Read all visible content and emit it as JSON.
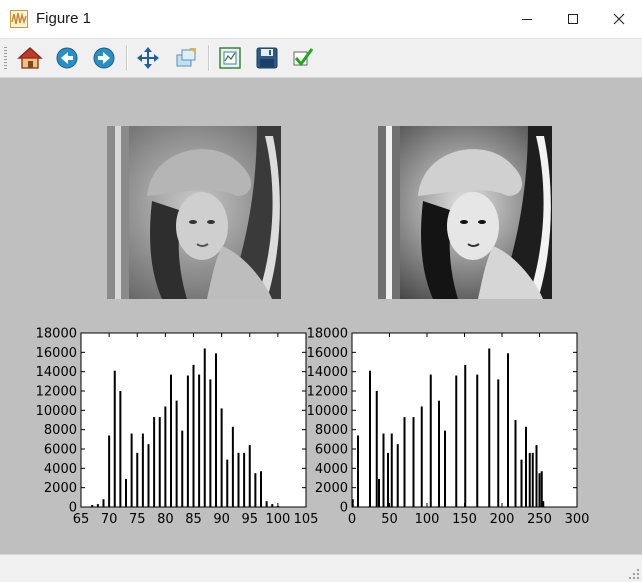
{
  "window": {
    "title": "Figure 1",
    "controls": [
      "minimize-icon",
      "maximize-icon",
      "close-icon"
    ]
  },
  "toolbar": {
    "buttons": [
      {
        "name": "home",
        "icon": "home-icon"
      },
      {
        "name": "back",
        "icon": "back-arrow-icon"
      },
      {
        "name": "forward",
        "icon": "forward-arrow-icon"
      },
      {
        "name": "pan",
        "icon": "pan-arrows-icon"
      },
      {
        "name": "zoom",
        "icon": "zoom-rect-icon"
      },
      {
        "name": "subplots",
        "icon": "subplots-config-icon"
      },
      {
        "name": "save",
        "icon": "floppy-save-icon"
      },
      {
        "name": "edit",
        "icon": "checkmark-edit-icon"
      }
    ]
  },
  "colors": {
    "figure_bg": "#bfbfbf",
    "axes_bg": "#ffffff",
    "bar": "#000000"
  },
  "images": [
    {
      "name": "original-lena-image",
      "content": "grayscale portrait photo"
    },
    {
      "name": "equalized-lena-image",
      "content": "grayscale portrait photo (equalized)"
    }
  ],
  "chart_data": [
    {
      "type": "bar",
      "xlim": [
        65,
        105
      ],
      "ylim": [
        0,
        18000
      ],
      "xticks": [
        "65",
        "70",
        "75",
        "80",
        "85",
        "90",
        "95",
        "100",
        "105"
      ],
      "yticks": [
        "0",
        "2000",
        "4000",
        "6000",
        "8000",
        "10000",
        "12000",
        "14000",
        "16000",
        "18000"
      ],
      "x": [
        67,
        68,
        69,
        70,
        71,
        72,
        73,
        74,
        75,
        76,
        77,
        78,
        79,
        80,
        81,
        82,
        83,
        84,
        85,
        86,
        87,
        88,
        89,
        90,
        91,
        92,
        93,
        94,
        95,
        96,
        97,
        98,
        99,
        100
      ],
      "values": [
        200,
        300,
        800,
        7400,
        14100,
        12000,
        2900,
        7600,
        5600,
        7600,
        6500,
        9300,
        9300,
        10400,
        13700,
        11000,
        7900,
        13600,
        14700,
        13700,
        16400,
        13200,
        15900,
        10200,
        4900,
        8300,
        5600,
        5600,
        6400,
        3500,
        3700,
        600,
        300,
        100
      ]
    },
    {
      "type": "bar",
      "xlim": [
        0,
        300
      ],
      "ylim": [
        0,
        18000
      ],
      "xticks": [
        "0",
        "50",
        "100",
        "150",
        "200",
        "250",
        "300"
      ],
      "yticks": [
        "0",
        "2000",
        "4000",
        "6000",
        "8000",
        "10000",
        "12000",
        "14000",
        "16000",
        "18000"
      ],
      "x": [
        1,
        8,
        24,
        33,
        36,
        42,
        48,
        53,
        61,
        70,
        82,
        93,
        105,
        116,
        124,
        139,
        151,
        167,
        183,
        195,
        208,
        218,
        226,
        232,
        237,
        241,
        246,
        250,
        253,
        255
      ],
      "values": [
        800,
        7400,
        14100,
        12000,
        2900,
        7600,
        5600,
        7600,
        6500,
        9300,
        9300,
        10400,
        13700,
        11000,
        7900,
        13600,
        14700,
        13700,
        16400,
        13200,
        15900,
        9000,
        4900,
        8300,
        5600,
        5600,
        6400,
        3500,
        3700,
        600
      ]
    }
  ]
}
